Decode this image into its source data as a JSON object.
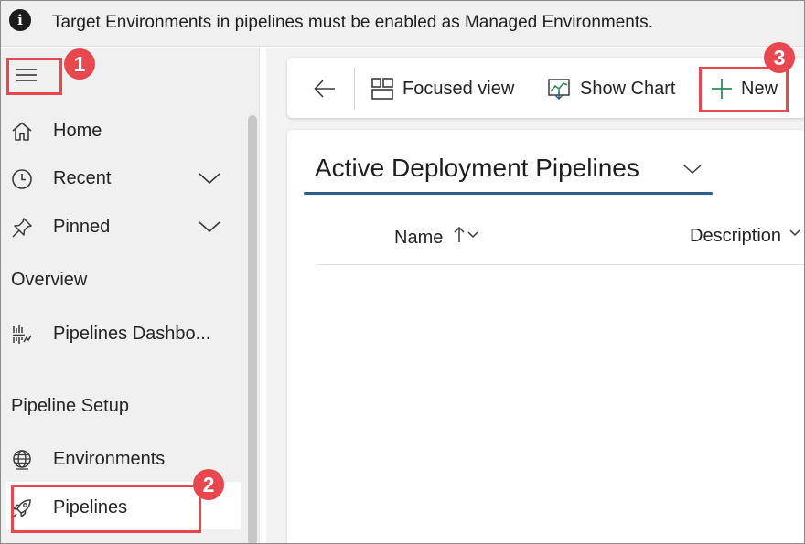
{
  "banner": {
    "icon": "info-icon",
    "message": "Target Environments in pipelines must be enabled as Managed Environments."
  },
  "sidebar": {
    "items": [
      {
        "label": "Home",
        "icon": "home-icon"
      },
      {
        "label": "Recent",
        "icon": "clock-icon",
        "expandable": true
      },
      {
        "label": "Pinned",
        "icon": "pin-icon",
        "expandable": true
      }
    ],
    "sections": [
      {
        "title": "Overview",
        "items": [
          {
            "label": "Pipelines Dashbo...",
            "icon": "dashboard-icon"
          }
        ]
      },
      {
        "title": "Pipeline Setup",
        "items": [
          {
            "label": "Environments",
            "icon": "globe-icon"
          },
          {
            "label": "Pipelines",
            "icon": "rocket-icon",
            "selected": true
          }
        ]
      }
    ]
  },
  "toolbar": {
    "back_icon": "arrow-left-icon",
    "focused_view_label": "Focused view",
    "show_chart_label": "Show Chart",
    "new_label": "New"
  },
  "view": {
    "title": "Active Deployment Pipelines",
    "columns": [
      {
        "label": "Name",
        "sort": "ascending"
      },
      {
        "label": "Description"
      }
    ]
  },
  "callouts": [
    "1",
    "2",
    "3"
  ],
  "colors": {
    "callout": "#e8474f",
    "accent_underline": "#2b5e8a",
    "chart_icon": "#2e8b57"
  }
}
